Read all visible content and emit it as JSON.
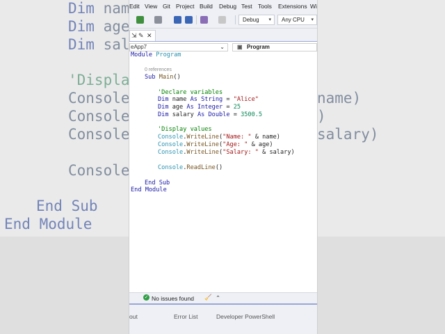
{
  "background": {
    "lines": [
      {
        "kw": "Dim",
        "text": " name"
      },
      {
        "kw": "Dim",
        "text": " age"
      },
      {
        "kw": "Dim",
        "text": " sala"
      },
      {
        "cm": "'Display"
      },
      {
        "text": "Console."
      },
      {
        "text": "Console."
      },
      {
        "text": "Console."
      },
      {
        "text": "Console."
      },
      {
        "kw": "End Sub",
        "text": ""
      },
      {
        "kw": "End Module",
        "text": ""
      }
    ],
    "right_fragments": [
      "name)",
      ")",
      "salary)"
    ]
  },
  "menu": {
    "items": [
      "Edit",
      "View",
      "Git",
      "Project",
      "Build",
      "Debug",
      "Test",
      "Tools",
      "Extensions",
      "Wi"
    ]
  },
  "toolbar": {
    "config": "Debug",
    "platform": "Any CPU"
  },
  "tab": {
    "label": "eApp7"
  },
  "navbar": {
    "member": "Program"
  },
  "code": {
    "refs": "0 references",
    "module_kw": "Module",
    "module_name": "Program",
    "sub_kw": "Sub",
    "sub_name": "Main",
    "sub_parens": "()",
    "comment1": "'Declare variables",
    "dim1_a": "Dim",
    "dim1_b": " name ",
    "dim1_c": "As",
    "dim1_d": " ",
    "dim1_e": "String",
    "dim1_f": " = ",
    "dim1_g": "\"Alice\"",
    "dim2_a": "Dim",
    "dim2_b": " age ",
    "dim2_c": "As",
    "dim2_d": " ",
    "dim2_e": "Integer",
    "dim2_f": " = ",
    "dim2_g": "25",
    "dim3_a": "Dim",
    "dim3_b": " salary ",
    "dim3_c": "As",
    "dim3_d": " ",
    "dim3_e": "Double",
    "dim3_f": " = ",
    "dim3_g": "3500.5",
    "comment2": "'Display values",
    "wl_cls": "Console",
    "wl_dot": ".",
    "wl_meth": "WriteLine",
    "wl1_open": "(",
    "wl1_str": "\"Name: \"",
    "wl1_rest": " & name)",
    "wl2_str": "\"Age: \"",
    "wl2_rest": " & age)",
    "wl3_str": "\"Salary: \"",
    "wl3_rest": " & salary)",
    "rl_meth": "ReadLine",
    "rl_rest": "()",
    "end_sub": "End Sub",
    "end_module": "End Module"
  },
  "status": {
    "issues": "No issues found"
  },
  "panel": {
    "tabs": [
      "out",
      "Error List",
      "Developer PowerShell"
    ]
  }
}
